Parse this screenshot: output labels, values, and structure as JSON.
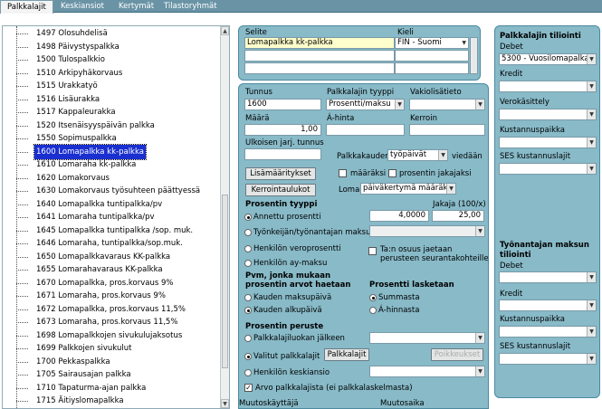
{
  "tabs": [
    "Palkkalajit",
    "Keskiansiot",
    "Kertymät",
    "Tilastoryhmät"
  ],
  "tree": {
    "items": [
      "1497 Olosuhdelisä",
      "1498 Päivystyspalkka",
      "1500 Tulospalkkio",
      "1510 Arkipyhäkorvaus",
      "1515 Urakkatyö",
      "1516 Lisäurakka",
      "1517 Kappaleurakka",
      "1520 Itsenäisyyspäivän palkka",
      "1550 Sopimuspalkka",
      "1600 Lomapalkka kk-palkka",
      "1610 Lomaraha kk-palkka",
      "1620 Lomakorvaus",
      "1630 Lomakorvaus työsuhteen päättyessä",
      "1640 Lomapalkka tuntipalkka/pv",
      "1641 Lomaraha tuntipalkka/pv",
      "1645 Lomapalkka tuntipalkka /sop. muk.",
      "1646 Lomaraha, tuntipalkka/sop.muk.",
      "1650 Lomapalkkavaraus KK-palkka",
      "1655 Lomarahavaraus KK-palkka",
      "1670 Lomapalkka, pros.korvaus 9%",
      "1671 Lomaraha, pros.korvaus 9%",
      "1672 Lomapalkka, pros.korvaus 11,5%",
      "1673 Lomaraha, pros.korvaus 11,5%",
      "1698 Lomapalkkojen sivukulujaksotus",
      "1699 Palkkojen sivukulut",
      "1700 Pekkaspalkka",
      "1705 Sairausajan palkka",
      "1710 Tapaturma-ajan palkka",
      "1715 Äitiyslomapalkka"
    ],
    "selected_index": 9
  },
  "desc": {
    "selite_label": "Selite",
    "kieli_label": "Kieli",
    "selite_value": "Lomapalkka kk-palkka",
    "kieli_value": "FIN - Suomi"
  },
  "form": {
    "tunnus_label": "Tunnus",
    "tunnus_value": "1600",
    "tyyppi_label": "Palkkalajin tyyppi",
    "tyyppi_value": "Prosentti/maksu",
    "vakio_label": "Vakiolisätieto",
    "maara_label": "Määrä",
    "maara_value": "1,00",
    "ahinta_label": "Á-hinta",
    "kerroin_label": "Kerroin",
    "ulkoinen_label": "Ulkoisen jarj. tunnus",
    "palkkakauden_label": "Palkkakauden",
    "palkkakauden_value": "työpäivät",
    "viedaan_label": "viedään",
    "lisamaaritykset_btn": "Lisämääritykset",
    "maaraksi_label": "määräksi",
    "prosentin_jakajaksi_label": "prosentin jakajaksi",
    "kerrointaulukot_btn": "Kerrointaulukot",
    "loma_label": "Loma",
    "loma_value": "päiväkertymä määräksi",
    "prosentin_tyyppi_title": "Prosentin tyyppi",
    "jakaja_label": "Jakaja (100/x)",
    "annettu_prosentti": "Annettu prosentti",
    "annettu_value": "4,0000",
    "jakaja_value": "25,00",
    "tyonantaja_maksu": "Työnkeijän/työnantajan maksu",
    "henkilon_veroprosentti": "Henkilön veroprosentti",
    "henkilon_ay_maksu": "Henkilön ay-maksu",
    "tan_osuus_1": "Ta:n osuus jaetaan",
    "tan_osuus_2": "perusteen seurantakohteille",
    "pvm_title_1": "Pvm, jonka mukaan",
    "pvm_title_2": "prosentin arvot haetaan",
    "kauden_maksupaiva": "Kauden maksupäivä",
    "kauden_alkupaiva": "Kauden alkupäivä",
    "prosentti_lasketaan_title": "Prosentti lasketaan",
    "summasta": "Summasta",
    "ahinnasta": "Á-hinnasta",
    "prosentin_peruste_title": "Prosentin peruste",
    "palkkalajiluokan_jalkeen": "Palkkalajiluokan jälkeen",
    "valitut_palkkalajit": "Valitut palkkalajit",
    "palkkalajit_btn": "Palkkalajit",
    "poikkeukset_btn": "Poikkeukset",
    "henkilon_keskiansio": "Henkilön keskiansio",
    "arvo_palkkalajista": "Arvo palkkalajista (ei palkkalaskelmasta)",
    "muutoskayttaja": "Muutoskäyttäjä",
    "muutosaika": "Muutosaika"
  },
  "tiliointi": {
    "title": "Palkkalajin tiliointi",
    "debet_label": "Debet",
    "debet_value": "5300 - Vuosilomapalkat",
    "kredit_label": "Kredit",
    "verokasittely_label": "Verokäsittely",
    "kustannuspaikka_label": "Kustannuspaikka",
    "ses_label": "SES kustannuslajit",
    "tyonantaja_title_1": "Työnantajan maksun",
    "tyonantaja_title_2": "tiliointi",
    "debet2_label": "Debet",
    "kredit2_label": "Kredit",
    "kustannuspaikka2_label": "Kustannuspaikka",
    "ses2_label": "SES kustannuslajit"
  }
}
